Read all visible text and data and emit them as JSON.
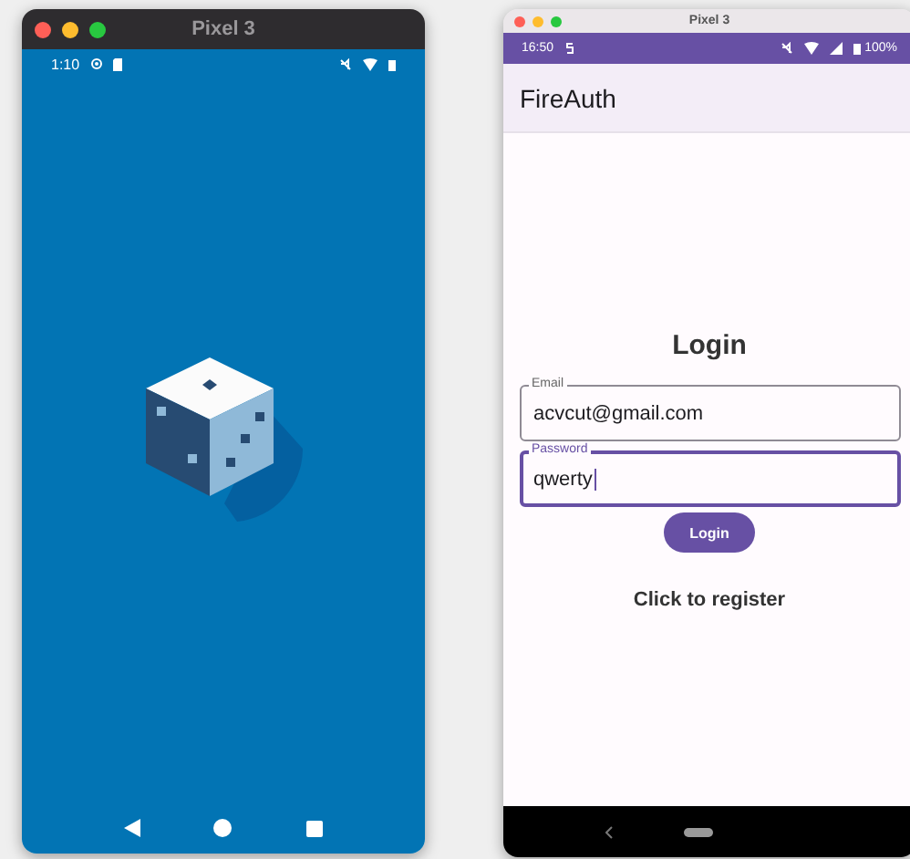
{
  "emulators": [
    {
      "kind": "splash",
      "window": {
        "title": "Pixel 3"
      },
      "status_bar": {
        "time": "1:10"
      }
    },
    {
      "kind": "app",
      "window": {
        "title": "Pixel 3"
      },
      "status_bar": {
        "time": "16:50",
        "battery": "100%"
      },
      "app_bar": {
        "title": "FireAuth"
      },
      "form": {
        "heading": "Login",
        "fields": [
          {
            "label": "Email",
            "value": "acvcut@gmail.com",
            "focused": false
          },
          {
            "label": "Password",
            "value": "qwerty",
            "focused": true
          }
        ],
        "button": "Login",
        "link": "Click to register"
      }
    }
  ]
}
